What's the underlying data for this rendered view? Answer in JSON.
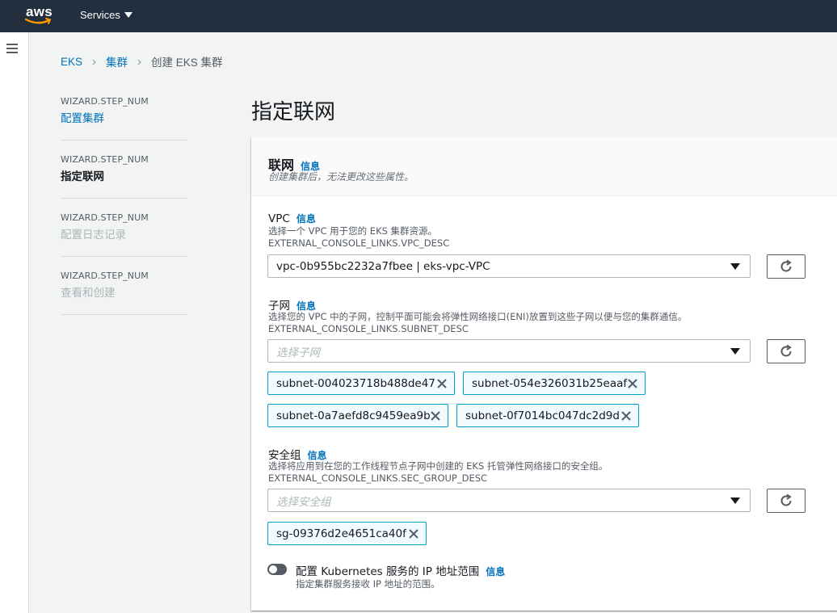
{
  "topnav": {
    "logo_text": "aws",
    "services_label": "Services"
  },
  "breadcrumb": {
    "items": [
      "EKS",
      "集群",
      "创建 EKS 集群"
    ]
  },
  "wizard": {
    "steps": [
      {
        "num": "WIZARD.STEP_NUM",
        "label": "配置集群",
        "state": "link"
      },
      {
        "num": "WIZARD.STEP_NUM",
        "label": "指定联网",
        "state": "active"
      },
      {
        "num": "WIZARD.STEP_NUM",
        "label": "配置日志记录",
        "state": "disabled"
      },
      {
        "num": "WIZARD.STEP_NUM",
        "label": "查看和创建",
        "state": "disabled"
      }
    ]
  },
  "page": {
    "title": "指定联网"
  },
  "panel": {
    "title": "联网",
    "info": "信息",
    "desc": "创建集群后，无法更改这些属性。"
  },
  "vpc": {
    "label": "VPC",
    "info": "信息",
    "desc": "选择一个 VPC 用于您的 EKS 集群资源。",
    "desc_link": "EXTERNAL_CONSOLE_LINKS.VPC_DESC",
    "value": "vpc-0b955bc2232a7fbee | eks-vpc-VPC"
  },
  "subnet": {
    "label": "子网",
    "info": "信息",
    "desc": "选择您的 VPC 中的子网，控制平面可能会将弹性网络接口(ENI)放置到这些子网以便与您的集群通信。",
    "desc_link": "EXTERNAL_CONSOLE_LINKS.SUBNET_DESC",
    "placeholder": "选择子网",
    "tokens": [
      "subnet-004023718b488de47",
      "subnet-054e326031b25eaaf",
      "subnet-0a7aefd8c9459ea9b",
      "subnet-0f7014bc047dc2d9d"
    ]
  },
  "security_group": {
    "label": "安全组",
    "info": "信息",
    "desc": "选择将应用到在您的工作线程节点子网中创建的 EKS 托管弹性网络接口的安全组。",
    "desc_link": "EXTERNAL_CONSOLE_LINKS.SEC_GROUP_DESC",
    "placeholder": "选择安全组",
    "tokens": [
      "sg-09376d2e4651ca40f"
    ]
  },
  "ip_range": {
    "label": "配置 Kubernetes 服务的 IP 地址范围",
    "info": "信息",
    "desc": "指定集群服务接收 IP 地址的范围。",
    "enabled": false
  },
  "colors": {
    "nav_bg": "#232f3e",
    "link": "#0073bb",
    "token_border": "#00a1c9",
    "token_bg": "#f1faff",
    "aws_orange": "#ff9900"
  }
}
